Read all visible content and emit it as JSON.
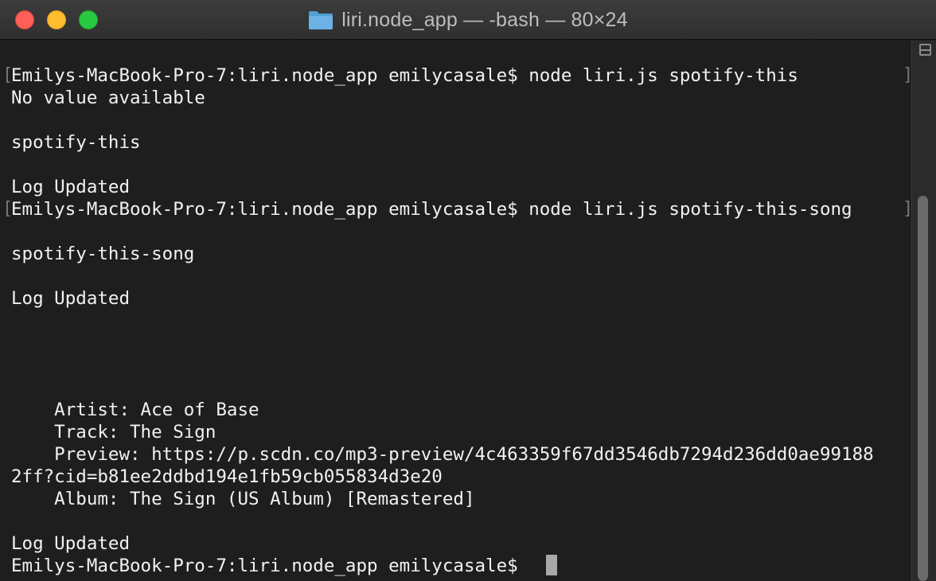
{
  "window": {
    "title": "liri.node_app — -bash — 80×24",
    "folder_icon": "folder-icon",
    "accent_colors": {
      "close": "#ff5f57",
      "minimize": "#febc2e",
      "zoom": "#28c840",
      "folder": "#6cb2e6"
    }
  },
  "terminal": {
    "lines": [
      "Emilys-MacBook-Pro-7:liri.node_app emilycasale$ node liri.js spotify-this",
      "No value available",
      "",
      "spotify-this",
      "",
      "Log Updated",
      "Emilys-MacBook-Pro-7:liri.node_app emilycasale$ node liri.js spotify-this-song",
      "",
      "spotify-this-song",
      "",
      "Log Updated",
      "",
      "",
      "",
      "",
      "    Artist: Ace of Base",
      "    Track: The Sign",
      "    Preview: https://p.scdn.co/mp3-preview/4c463359f67dd3546db7294d236dd0ae99188",
      "2ff?cid=b81ee2ddbd194e1fb59cb055834d3e20",
      "    Album: The Sign (US Album) [Remastered]",
      "",
      "Log Updated",
      "Emilys-MacBook-Pro-7:liri.node_app emilycasale$ "
    ],
    "text_color": "#f2f2f2",
    "background_color": "#1e1e1e"
  }
}
